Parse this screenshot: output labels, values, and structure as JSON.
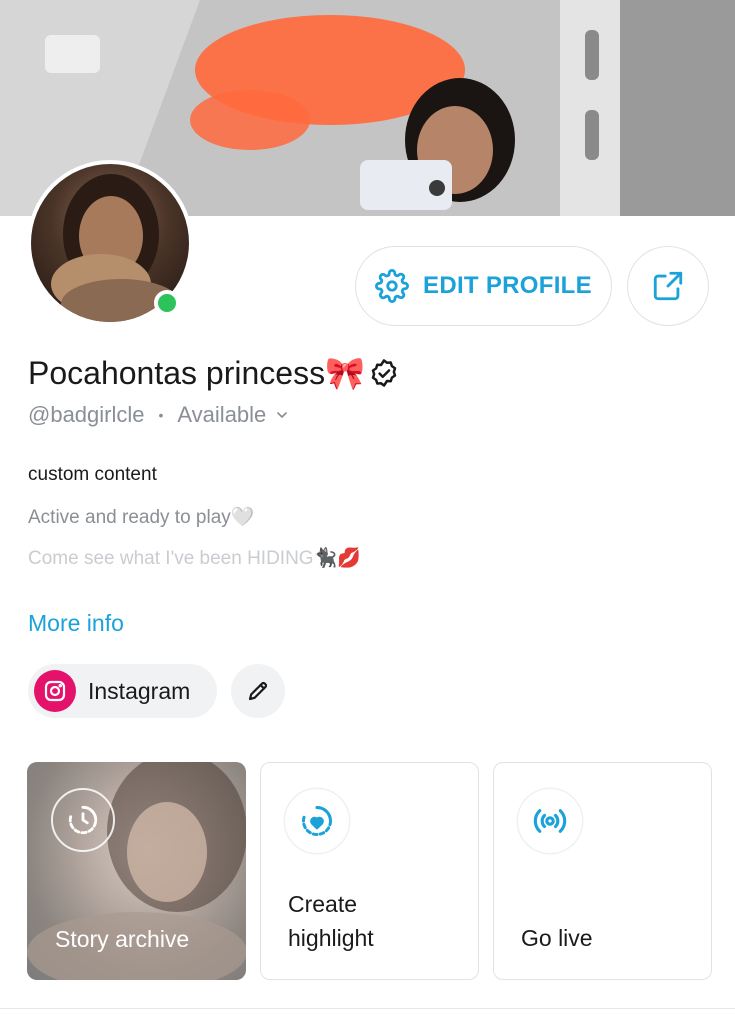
{
  "profile": {
    "display_name": "Pocahontas princess🎀",
    "handle": "@badgirlcle",
    "status": "Available",
    "bio": {
      "line1": "custom content",
      "line2": "Active and ready to play🤍",
      "line3": "Come see what I've been HIDING🐈‍⬛💋"
    },
    "more_info": "More info",
    "online": true
  },
  "actions": {
    "edit_profile": "EDIT PROFILE",
    "share_icon": "share-icon"
  },
  "links": {
    "instagram_label": "Instagram"
  },
  "cards": [
    {
      "label": "Story archive",
      "icon": "history-clock-icon"
    },
    {
      "label": "Create highlight",
      "icon": "heart-circle-icon"
    },
    {
      "label": "Go live",
      "icon": "broadcast-icon"
    }
  ],
  "colors": {
    "accent": "#1ba2d8",
    "online": "#2ec35a",
    "instagram": "#e4126b"
  }
}
